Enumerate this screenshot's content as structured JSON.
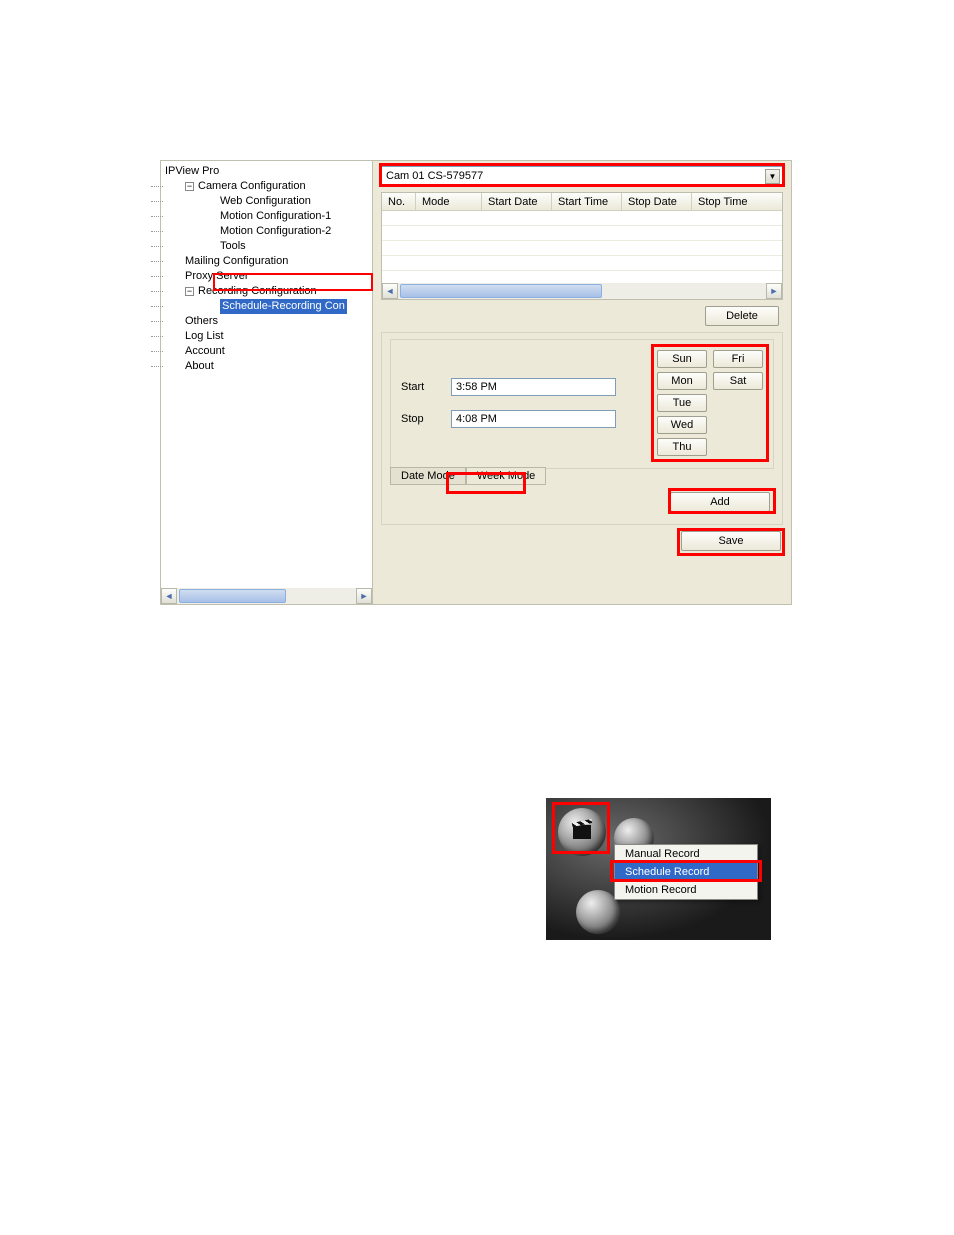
{
  "tree": {
    "root": "IPView Pro",
    "camera_config": "Camera Configuration",
    "web_config": "Web Configuration",
    "motion1": "Motion Configuration-1",
    "motion2": "Motion Configuration-2",
    "tools": "Tools",
    "mailing": "Mailing Configuration",
    "proxy": "Proxy Server",
    "rec_config": "Recording Configuration",
    "schedule_rec": "Schedule-Recording Con",
    "others": "Others",
    "loglist": "Log List",
    "account": "Account",
    "about": "About"
  },
  "camera_select": {
    "text": "Cam 01     CS-579577"
  },
  "table": {
    "headers": {
      "no": "No.",
      "mode": "Mode",
      "start_date": "Start Date",
      "start_time": "Start Time",
      "stop_date": "Stop Date",
      "stop_time": "Stop Time"
    },
    "rows": []
  },
  "buttons": {
    "delete": "Delete",
    "add": "Add",
    "save": "Save"
  },
  "form": {
    "start_label": "Start",
    "stop_label": "Stop",
    "start_value": "3:58 PM",
    "stop_value": "4:08 PM"
  },
  "days": {
    "sun": "Sun",
    "mon": "Mon",
    "tue": "Tue",
    "wed": "Wed",
    "thu": "Thu",
    "fri": "Fri",
    "sat": "Sat"
  },
  "tabs": {
    "date_mode": "Date Mode",
    "week_mode": "Week Mode"
  },
  "context_menu": {
    "manual": "Manual Record",
    "schedule": "Schedule Record",
    "motion": "Motion Record"
  },
  "expander_minus": "−",
  "dd_arrow": "▼",
  "scroll_left": "◄",
  "scroll_right": "►"
}
